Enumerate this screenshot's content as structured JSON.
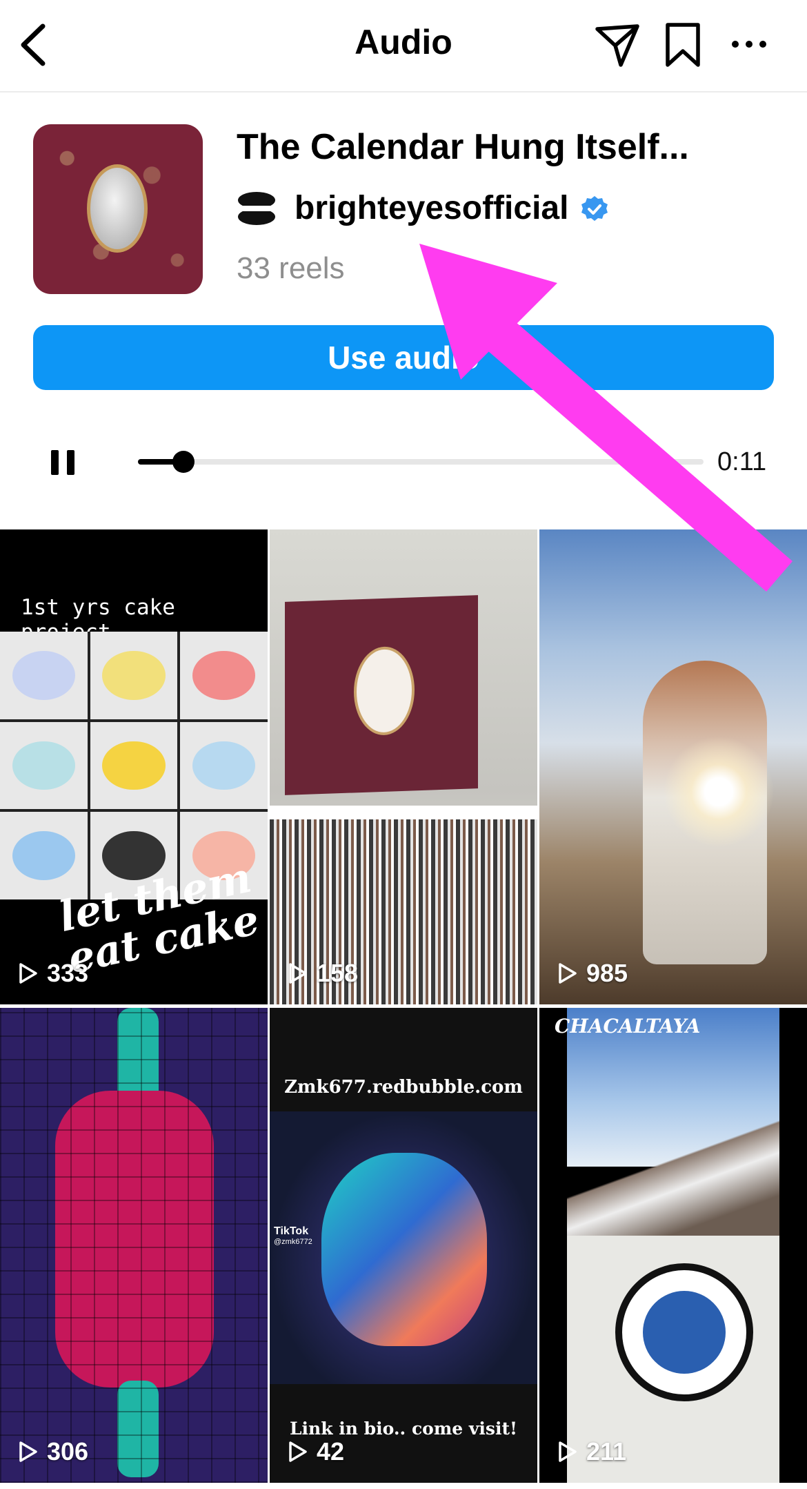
{
  "header": {
    "title": "Audio",
    "icons": [
      "back-chevron-icon",
      "send-icon",
      "bookmark-icon",
      "more-icon"
    ]
  },
  "audio": {
    "title": "The Calendar Hung Itself...",
    "artist": "brighteyesofficial",
    "verified": true,
    "reels_count": "33 reels",
    "use_audio_label": "Use audio",
    "accent_color": "#0d96f6"
  },
  "player": {
    "state": "playing",
    "progress": 0.08,
    "time": "0:11"
  },
  "reels": [
    {
      "views": "333",
      "caption": "1st yrs cake project",
      "overlay": "let them eat cake"
    },
    {
      "views": "158"
    },
    {
      "views": "985"
    },
    {
      "views": "306"
    },
    {
      "views": "42",
      "top_text": "Zmk677.redbubble.com",
      "bottom_text": "Link in bio.. come visit!",
      "badge": "TikTok",
      "handle": "@zmk6772"
    },
    {
      "views": "211",
      "caption": "CHACALTAYA"
    }
  ],
  "annotation": {
    "color": "#ff3cf0"
  }
}
